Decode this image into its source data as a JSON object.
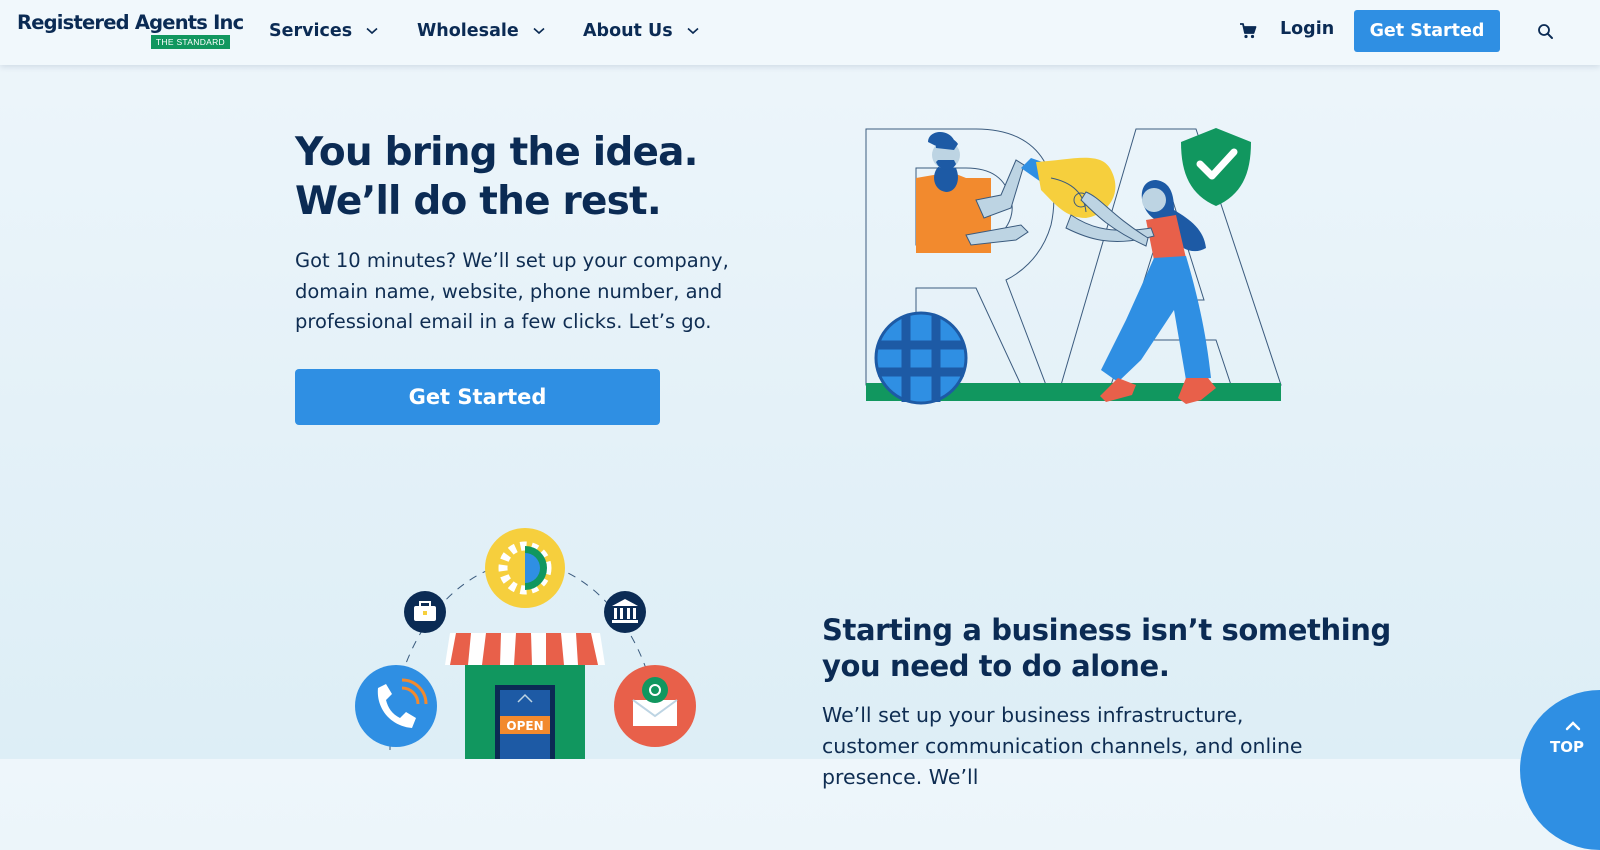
{
  "header": {
    "logo_text": "Registered Agents Inc",
    "logo_tag": "THE STANDARD",
    "nav": [
      {
        "label": "Services"
      },
      {
        "label": "Wholesale"
      },
      {
        "label": "About Us"
      }
    ],
    "login_label": "Login",
    "cta_label": "Get Started",
    "icons": [
      "cart-icon",
      "search-icon",
      "chevron-down-icon"
    ]
  },
  "hero": {
    "title_line1": "You bring the idea.",
    "title_line2": "We’ll do the rest.",
    "text": "Got 10 minutes? We’ll set up your company, domain name, website, phone number, and professional email in a few clicks. Let’s go.",
    "cta_label": "Get Started",
    "art_tag_open": "OPEN"
  },
  "section2": {
    "title_line1": "Starting a business isn’t something",
    "title_line2": "you need to do alone.",
    "text": "We’ll set up your business infrastructure, customer communication channels, and online presence. We’ll",
    "open_sign": "OPEN"
  },
  "top_button": {
    "label": "TOP"
  },
  "colors": {
    "navy": "#0b2b54",
    "accent_blue": "#2f8fe3",
    "brand_green": "#11975f",
    "orange": "#f28a2e",
    "coral": "#e8604a",
    "yellow": "#f6cf3d",
    "background": "#e8f3f9"
  }
}
